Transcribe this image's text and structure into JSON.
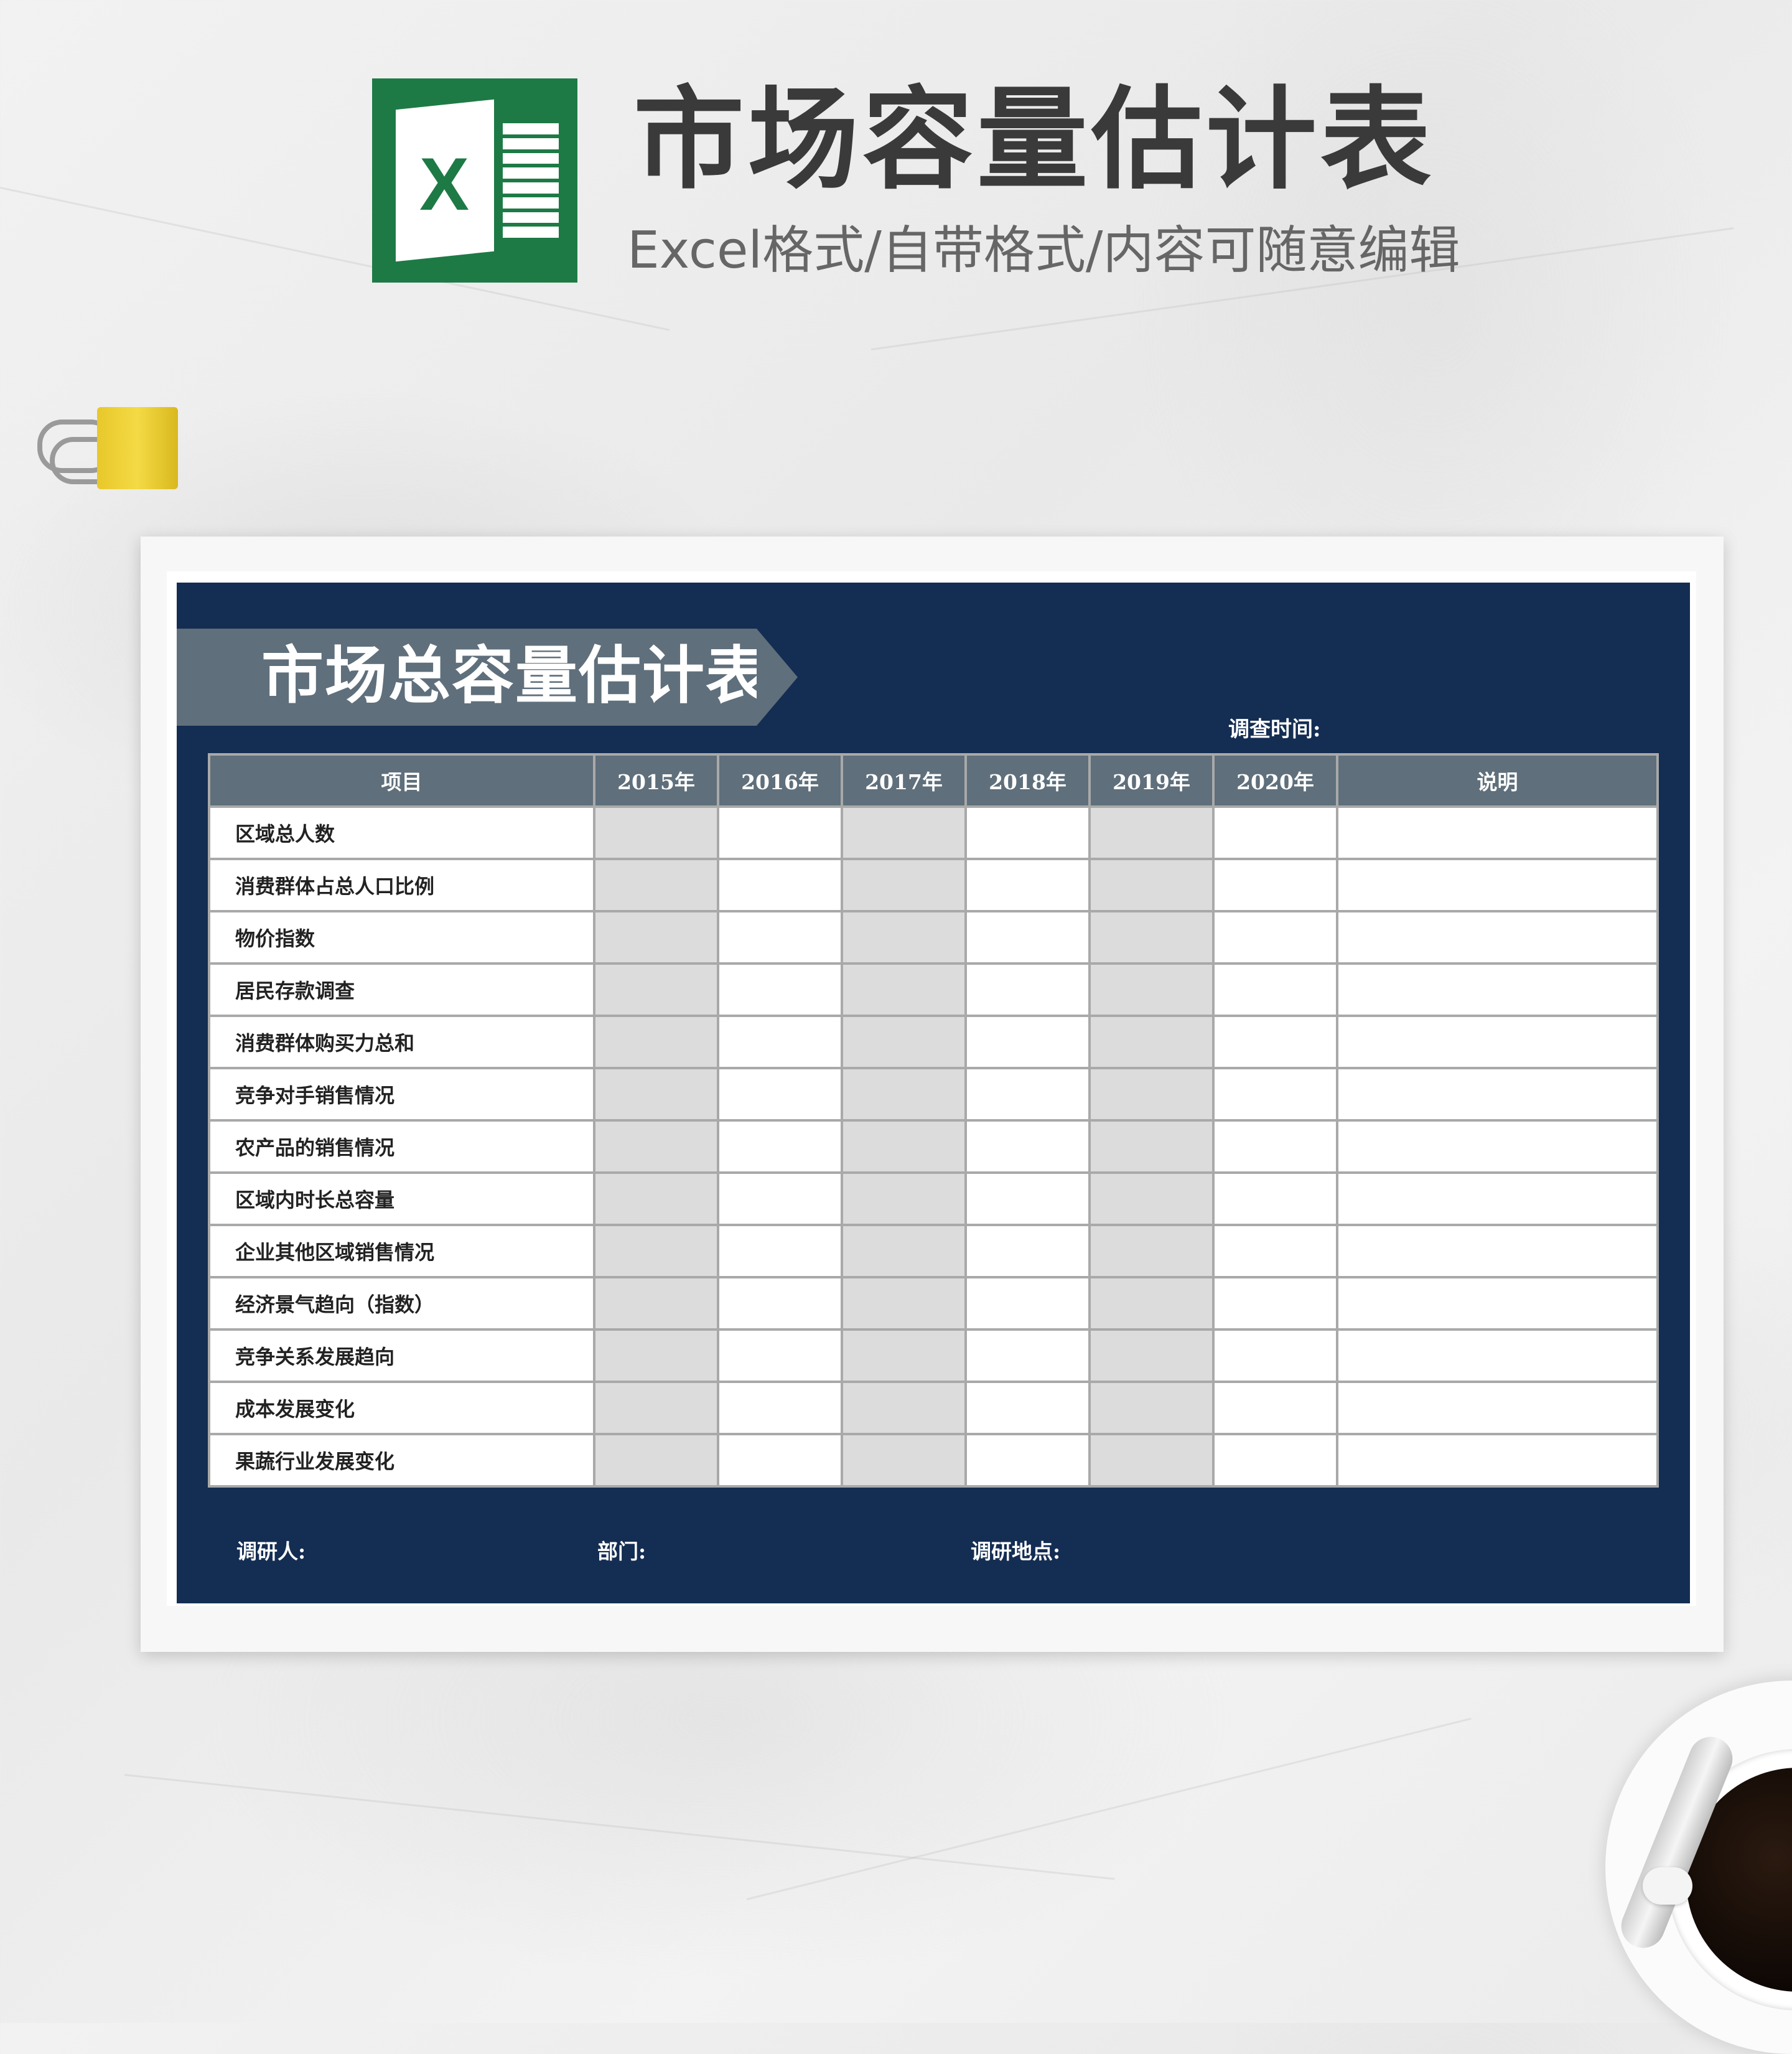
{
  "header": {
    "title": "市场容量估计表",
    "subtitle": "Excel格式/自带格式/内容可随意编辑",
    "logo_letter": "X",
    "logo_icon": "excel-logo-icon"
  },
  "colors": {
    "sheet_bg": "#142d52",
    "header_cell_bg": "#5f6f7b",
    "banner_bg": "#5f6f7b",
    "shade_cell_bg": "#dcdcdc",
    "excel_green": "#1e7a45"
  },
  "sheet": {
    "title": "市场总容量估计表",
    "survey_time_label": "调查时间:",
    "columns": [
      "项目",
      "2015年",
      "2016年",
      "2017年",
      "2018年",
      "2019年",
      "2020年",
      "说明"
    ],
    "shaded_columns": [
      "2015年",
      "2017年",
      "2019年"
    ],
    "rows": [
      "区域总人数",
      "消费群体占总人口比例",
      "物价指数",
      "居民存款调查",
      "消费群体购买力总和",
      "竞争对手销售情况",
      "农产品的销售情况",
      "区域内时长总容量",
      "企业其他区域销售情况",
      "经济景气趋向（指数）",
      "竞争关系发展趋向",
      "成本发展变化",
      "果蔬行业发展变化"
    ],
    "footer": {
      "researcher_label": "调研人:",
      "department_label": "部门:",
      "location_label": "调研地点:"
    }
  },
  "decor": {
    "clip_icon": "binder-clip-icon",
    "cup_icon": "coffee-cup-icon"
  }
}
